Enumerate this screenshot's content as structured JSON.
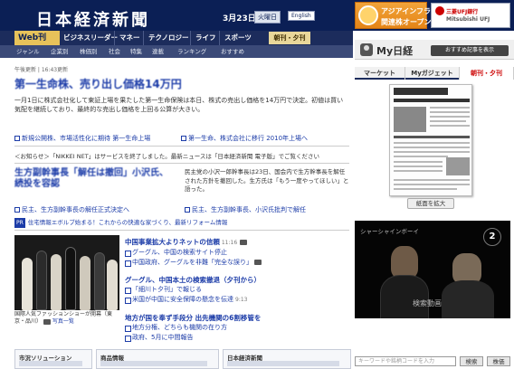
{
  "header": {
    "logo": "日本経済新聞",
    "date": "3月23日",
    "weekday": "火曜日",
    "english_label": "English",
    "ad_asia": {
      "line1": "アジアインフラ",
      "line2": "関連株オープン"
    },
    "ad_bank": {
      "line1": "三菱UFJ銀行",
      "line2": "Mitsubishi UFJ"
    }
  },
  "nav": {
    "web_label": "Web刊",
    "items": [
      "ビジネスリーダー",
      "マネー",
      "テクノロジー",
      "ライフ",
      "スポーツ"
    ],
    "paper_label": "朝刊・夕刊"
  },
  "subnav": {
    "items": [
      "ジャンル",
      "企業別",
      "株価別",
      "社会",
      "特集",
      "連載",
      "ランキング",
      "ランキング",
      "おすすめ"
    ]
  },
  "my_nikkei": {
    "title": "My日経",
    "register_label": "おすすめ記事を表示"
  },
  "top_story": {
    "meta": "午後更新 | 16:43更新",
    "headline": "第一生命株、売り出し価格14万円",
    "lead": "一月1日に株式会社化して東証上場を果たした第一生命保険は本日、株式の売出し価格を14万円で決定。初値は買い気配を継続しており、最終的な売出し価格を上回る公算が大きい。",
    "related": [
      "新規公開株、市場活性化に期待 第一生命上場",
      "第一生命、株式会社に移行 2010年上場へ"
    ],
    "notice": "＜お知らせ＞「NIKKEI NET」はサービスを終了しました。最新ニュースは「日本経済新聞 電子版」でご覧ください"
  },
  "second_story": {
    "headline": "生方副幹事長「解任は撤回」小沢氏、続投を容認",
    "body": "民主党の小沢一郎幹事長は23日、国会内で生方幹事長を解任された方針を撤回した。生方氏は「もう一度やってほしい」と語った。",
    "related": [
      "民主、生方副幹事長の解任正式決定へ",
      "民主、生方副幹事長、小沢氏批判で解任"
    ]
  },
  "promo": {
    "tag": "PR",
    "text": "住宅情報エボルブ始まる！これからの快適な家づくり、最新リフォーム情報"
  },
  "photo": {
    "caption": "国際人気ファッションショーが開幕（東京・品川）",
    "more_label": "写真一覧"
  },
  "news_list": [
    {
      "title": "中国事業拡大よりネットの信頼",
      "time": "11:16",
      "subs": [
        {
          "text": "グーグル、中国の検索サイト停止",
          "time": ""
        },
        {
          "text": "中国政府、グーグルを非難「完全な誤り」",
          "time": ""
        }
      ]
    },
    {
      "title": "グーグル、中国本土の検索撤退（夕刊から）",
      "time": "",
      "subs": [
        {
          "text": "「細川ト夕刊」で報じる",
          "time": ""
        },
        {
          "text": "米国が中国に安全保障の懸念を伝達",
          "time": "9:13"
        }
      ]
    },
    {
      "title": "地方が国を奉ず手段分 出先機関の6割移管を",
      "time": "",
      "subs": [
        {
          "text": "地方分権、どちらも機関の在り方",
          "time": ""
        },
        {
          "text": "政府、5月に中間報告",
          "time": ""
        }
      ]
    }
  ],
  "bottom_boxes": [
    {
      "title": "市況ソリューション"
    },
    {
      "title": "商品情報"
    },
    {
      "title": "日本経済新聞"
    }
  ],
  "right": {
    "tabs": [
      "マーケット",
      "Myガジェット",
      "朝刊・夕刊"
    ],
    "active_tab": 2,
    "enlarge_label": "紙面を拡大",
    "video": {
      "title": "シャーシャインボーイ",
      "logo": "2",
      "label": "検索動画"
    },
    "search": {
      "placeholder": "キーワードや銘柄コードを入力",
      "btn1": "検索",
      "btn2": "株価"
    }
  }
}
